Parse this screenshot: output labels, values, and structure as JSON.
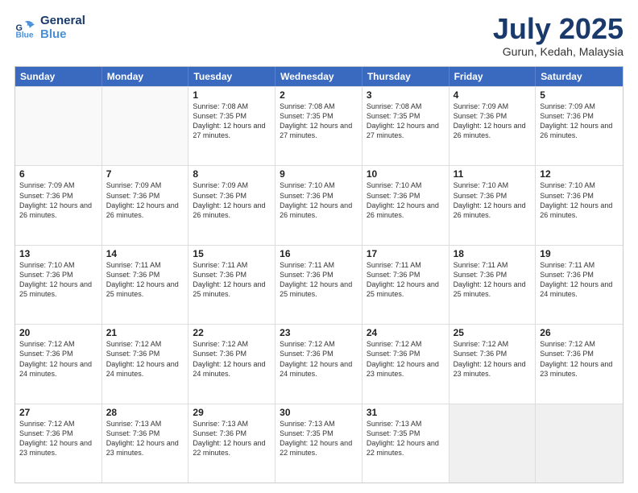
{
  "header": {
    "logo_general": "General",
    "logo_blue": "Blue",
    "month_title": "July 2025",
    "subtitle": "Gurun, Kedah, Malaysia"
  },
  "days_of_week": [
    "Sunday",
    "Monday",
    "Tuesday",
    "Wednesday",
    "Thursday",
    "Friday",
    "Saturday"
  ],
  "weeks": [
    [
      {
        "day": "",
        "sunrise": "",
        "sunset": "",
        "daylight": "",
        "empty": true
      },
      {
        "day": "",
        "sunrise": "",
        "sunset": "",
        "daylight": "",
        "empty": true
      },
      {
        "day": "1",
        "sunrise": "Sunrise: 7:08 AM",
        "sunset": "Sunset: 7:35 PM",
        "daylight": "Daylight: 12 hours and 27 minutes."
      },
      {
        "day": "2",
        "sunrise": "Sunrise: 7:08 AM",
        "sunset": "Sunset: 7:35 PM",
        "daylight": "Daylight: 12 hours and 27 minutes."
      },
      {
        "day": "3",
        "sunrise": "Sunrise: 7:08 AM",
        "sunset": "Sunset: 7:35 PM",
        "daylight": "Daylight: 12 hours and 27 minutes."
      },
      {
        "day": "4",
        "sunrise": "Sunrise: 7:09 AM",
        "sunset": "Sunset: 7:36 PM",
        "daylight": "Daylight: 12 hours and 26 minutes."
      },
      {
        "day": "5",
        "sunrise": "Sunrise: 7:09 AM",
        "sunset": "Sunset: 7:36 PM",
        "daylight": "Daylight: 12 hours and 26 minutes."
      }
    ],
    [
      {
        "day": "6",
        "sunrise": "Sunrise: 7:09 AM",
        "sunset": "Sunset: 7:36 PM",
        "daylight": "Daylight: 12 hours and 26 minutes."
      },
      {
        "day": "7",
        "sunrise": "Sunrise: 7:09 AM",
        "sunset": "Sunset: 7:36 PM",
        "daylight": "Daylight: 12 hours and 26 minutes."
      },
      {
        "day": "8",
        "sunrise": "Sunrise: 7:09 AM",
        "sunset": "Sunset: 7:36 PM",
        "daylight": "Daylight: 12 hours and 26 minutes."
      },
      {
        "day": "9",
        "sunrise": "Sunrise: 7:10 AM",
        "sunset": "Sunset: 7:36 PM",
        "daylight": "Daylight: 12 hours and 26 minutes."
      },
      {
        "day": "10",
        "sunrise": "Sunrise: 7:10 AM",
        "sunset": "Sunset: 7:36 PM",
        "daylight": "Daylight: 12 hours and 26 minutes."
      },
      {
        "day": "11",
        "sunrise": "Sunrise: 7:10 AM",
        "sunset": "Sunset: 7:36 PM",
        "daylight": "Daylight: 12 hours and 26 minutes."
      },
      {
        "day": "12",
        "sunrise": "Sunrise: 7:10 AM",
        "sunset": "Sunset: 7:36 PM",
        "daylight": "Daylight: 12 hours and 26 minutes."
      }
    ],
    [
      {
        "day": "13",
        "sunrise": "Sunrise: 7:10 AM",
        "sunset": "Sunset: 7:36 PM",
        "daylight": "Daylight: 12 hours and 25 minutes."
      },
      {
        "day": "14",
        "sunrise": "Sunrise: 7:11 AM",
        "sunset": "Sunset: 7:36 PM",
        "daylight": "Daylight: 12 hours and 25 minutes."
      },
      {
        "day": "15",
        "sunrise": "Sunrise: 7:11 AM",
        "sunset": "Sunset: 7:36 PM",
        "daylight": "Daylight: 12 hours and 25 minutes."
      },
      {
        "day": "16",
        "sunrise": "Sunrise: 7:11 AM",
        "sunset": "Sunset: 7:36 PM",
        "daylight": "Daylight: 12 hours and 25 minutes."
      },
      {
        "day": "17",
        "sunrise": "Sunrise: 7:11 AM",
        "sunset": "Sunset: 7:36 PM",
        "daylight": "Daylight: 12 hours and 25 minutes."
      },
      {
        "day": "18",
        "sunrise": "Sunrise: 7:11 AM",
        "sunset": "Sunset: 7:36 PM",
        "daylight": "Daylight: 12 hours and 25 minutes."
      },
      {
        "day": "19",
        "sunrise": "Sunrise: 7:11 AM",
        "sunset": "Sunset: 7:36 PM",
        "daylight": "Daylight: 12 hours and 24 minutes."
      }
    ],
    [
      {
        "day": "20",
        "sunrise": "Sunrise: 7:12 AM",
        "sunset": "Sunset: 7:36 PM",
        "daylight": "Daylight: 12 hours and 24 minutes."
      },
      {
        "day": "21",
        "sunrise": "Sunrise: 7:12 AM",
        "sunset": "Sunset: 7:36 PM",
        "daylight": "Daylight: 12 hours and 24 minutes."
      },
      {
        "day": "22",
        "sunrise": "Sunrise: 7:12 AM",
        "sunset": "Sunset: 7:36 PM",
        "daylight": "Daylight: 12 hours and 24 minutes."
      },
      {
        "day": "23",
        "sunrise": "Sunrise: 7:12 AM",
        "sunset": "Sunset: 7:36 PM",
        "daylight": "Daylight: 12 hours and 24 minutes."
      },
      {
        "day": "24",
        "sunrise": "Sunrise: 7:12 AM",
        "sunset": "Sunset: 7:36 PM",
        "daylight": "Daylight: 12 hours and 23 minutes."
      },
      {
        "day": "25",
        "sunrise": "Sunrise: 7:12 AM",
        "sunset": "Sunset: 7:36 PM",
        "daylight": "Daylight: 12 hours and 23 minutes."
      },
      {
        "day": "26",
        "sunrise": "Sunrise: 7:12 AM",
        "sunset": "Sunset: 7:36 PM",
        "daylight": "Daylight: 12 hours and 23 minutes."
      }
    ],
    [
      {
        "day": "27",
        "sunrise": "Sunrise: 7:12 AM",
        "sunset": "Sunset: 7:36 PM",
        "daylight": "Daylight: 12 hours and 23 minutes."
      },
      {
        "day": "28",
        "sunrise": "Sunrise: 7:13 AM",
        "sunset": "Sunset: 7:36 PM",
        "daylight": "Daylight: 12 hours and 23 minutes."
      },
      {
        "day": "29",
        "sunrise": "Sunrise: 7:13 AM",
        "sunset": "Sunset: 7:36 PM",
        "daylight": "Daylight: 12 hours and 22 minutes."
      },
      {
        "day": "30",
        "sunrise": "Sunrise: 7:13 AM",
        "sunset": "Sunset: 7:35 PM",
        "daylight": "Daylight: 12 hours and 22 minutes."
      },
      {
        "day": "31",
        "sunrise": "Sunrise: 7:13 AM",
        "sunset": "Sunset: 7:35 PM",
        "daylight": "Daylight: 12 hours and 22 minutes."
      },
      {
        "day": "",
        "sunrise": "",
        "sunset": "",
        "daylight": "",
        "empty": true
      },
      {
        "day": "",
        "sunrise": "",
        "sunset": "",
        "daylight": "",
        "empty": true
      }
    ]
  ]
}
